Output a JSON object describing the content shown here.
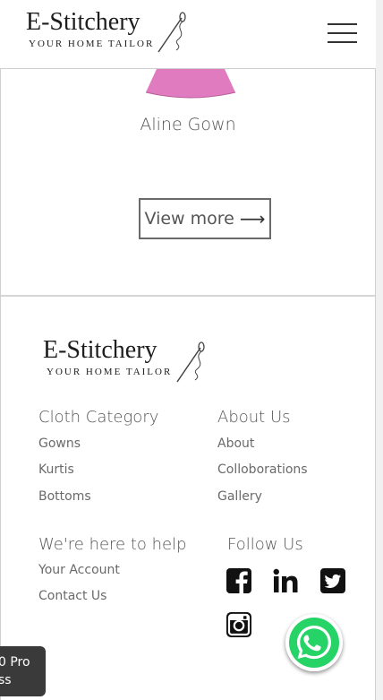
{
  "header": {
    "brand": "E-Stitchery",
    "tagline": "YOUR HOME TAILOR",
    "menu_icon": "hamburger-menu-icon"
  },
  "product": {
    "name": "Aline Gown",
    "skirt_color": "#e07bbf"
  },
  "view_more": {
    "label": "View more",
    "arrow": "⟶"
  },
  "footer": {
    "brand": "E-Stitchery",
    "tagline": "YOUR HOME TAILOR",
    "cloth_category": {
      "title": "Cloth Category",
      "links": [
        "Gowns",
        "Kurtis",
        "Bottoms"
      ]
    },
    "about_us": {
      "title": "About Us",
      "links": [
        "About",
        "Colloborations",
        "Gallery"
      ]
    },
    "help": {
      "title": "We're here to help",
      "links": [
        "Your Account",
        "Contact Us"
      ]
    },
    "follow": {
      "title": "Follow Us",
      "icons": [
        "facebook-icon",
        "linkedin-icon",
        "twitter-icon",
        "instagram-icon"
      ]
    }
  },
  "whatsapp": {
    "icon": "whatsapp-icon",
    "color": "#25d366"
  },
  "badge": {
    "line1": "0 Pro",
    "line2": "ss"
  }
}
